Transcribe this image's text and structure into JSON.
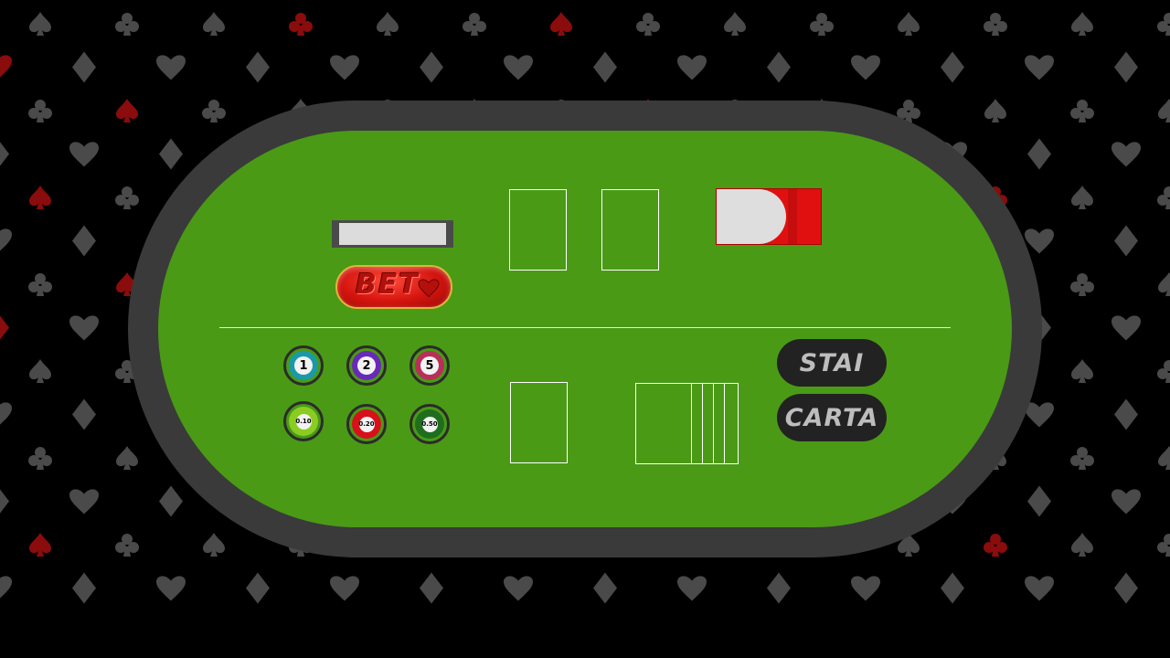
{
  "background": {
    "pattern": [
      "spade-icon",
      "club-icon",
      "heart-icon",
      "diamond-icon"
    ],
    "colors": {
      "base": "#000000",
      "suit_gray": "#4a4a4a",
      "suit_red": "#8a0c0c"
    }
  },
  "table": {
    "rail_color": "#3a3a3a",
    "felt_color": "#4a9a16"
  },
  "bet": {
    "display_value": "",
    "button_label": "BET",
    "button_icon": "heart-icon"
  },
  "chips": [
    {
      "label": "1",
      "color": "#1a9aa8"
    },
    {
      "label": "2",
      "color": "#6a28b8"
    },
    {
      "label": "5",
      "color": "#b8305a"
    },
    {
      "label": "0.10",
      "color": "#8acc22"
    },
    {
      "label": "0.20",
      "color": "#d8101a"
    },
    {
      "label": "0.50",
      "color": "#1e6e1e"
    }
  ],
  "actions": {
    "stand_label": "STAI",
    "hit_label": "CARTA"
  },
  "deck": {
    "colors": {
      "back": "#e01010",
      "face": "#dedede"
    }
  }
}
